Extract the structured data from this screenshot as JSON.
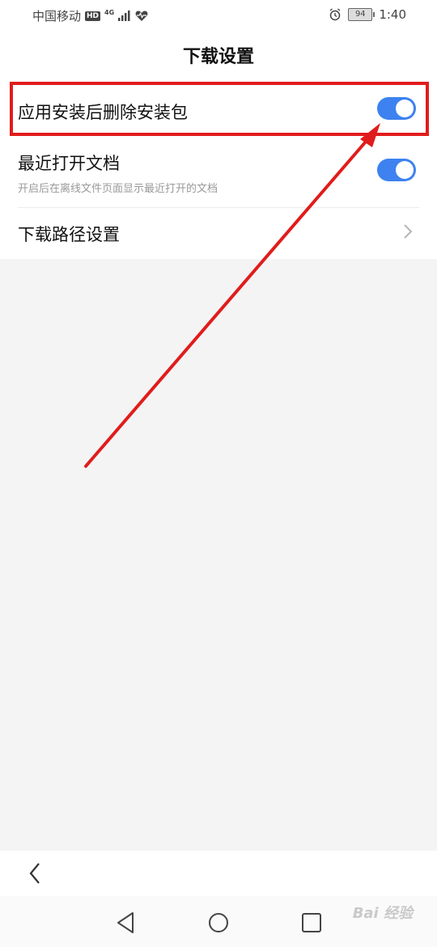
{
  "status_bar": {
    "carrier": "中国移动",
    "hd_badge": "HD",
    "network_type": "4G",
    "battery_level": "94",
    "time": "1:40"
  },
  "header": {
    "title": "下载设置"
  },
  "settings": {
    "items": [
      {
        "label": "应用安装后删除安装包",
        "toggle_on": true
      },
      {
        "label": "最近打开文档",
        "subtitle": "开启后在离线文件页面显示最近打开的文档",
        "toggle_on": true
      },
      {
        "label": "下载路径设置"
      }
    ]
  },
  "colors": {
    "toggle_on": "#3d82f0",
    "annotation_red": "#e11c1c"
  },
  "watermark": {
    "text": "Bai 经验"
  }
}
